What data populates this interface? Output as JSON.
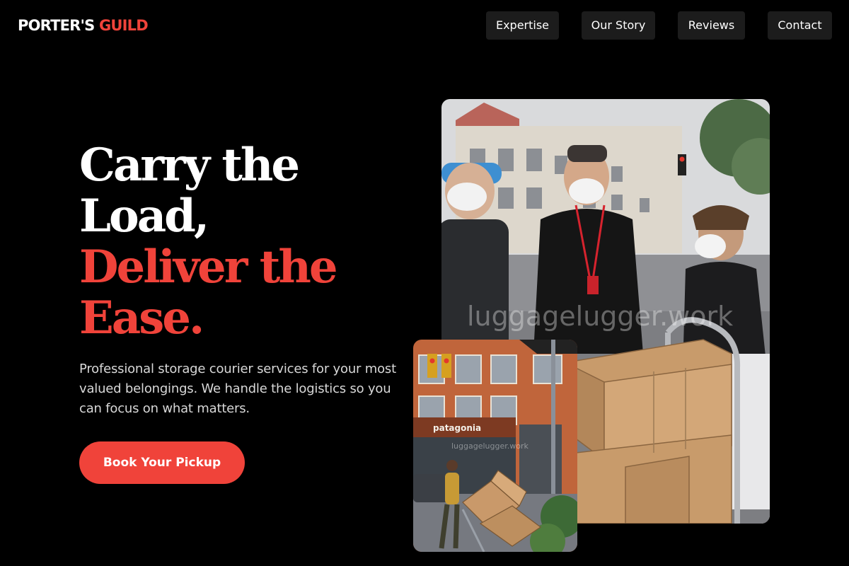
{
  "brand": {
    "name_part1": "PORTER'S",
    "name_part2": "GUILD",
    "accent_color": "#f0433a"
  },
  "nav": {
    "items": [
      {
        "label": "Expertise"
      },
      {
        "label": "Our Story"
      },
      {
        "label": "Reviews"
      },
      {
        "label": "Contact"
      }
    ]
  },
  "hero": {
    "headline_line1": "Carry the",
    "headline_line2": "Load,",
    "headline_line3": "Deliver the",
    "headline_line4": "Ease.",
    "subtext": "Professional storage courier services for your most valued belongings. We handle the logistics so you can focus on what matters.",
    "cta_label": "Book Your Pickup"
  },
  "images": {
    "main": {
      "alt": "Three masked couriers with red lanyards standing beside a hand truck stacked with cardboard boxes on a city street",
      "watermark": "luggagelugger.work"
    },
    "secondary": {
      "alt": "Courier pushing a hand truck loaded with boxes past a brick storefront",
      "store_sign": "patagonia",
      "watermark": "luggagelugger.work"
    }
  },
  "colors": {
    "background": "#000000",
    "nav_button_bg": "#1c1c1c",
    "accent": "#f0433a",
    "text": "#ffffff",
    "subtext": "#d8d8d8"
  }
}
